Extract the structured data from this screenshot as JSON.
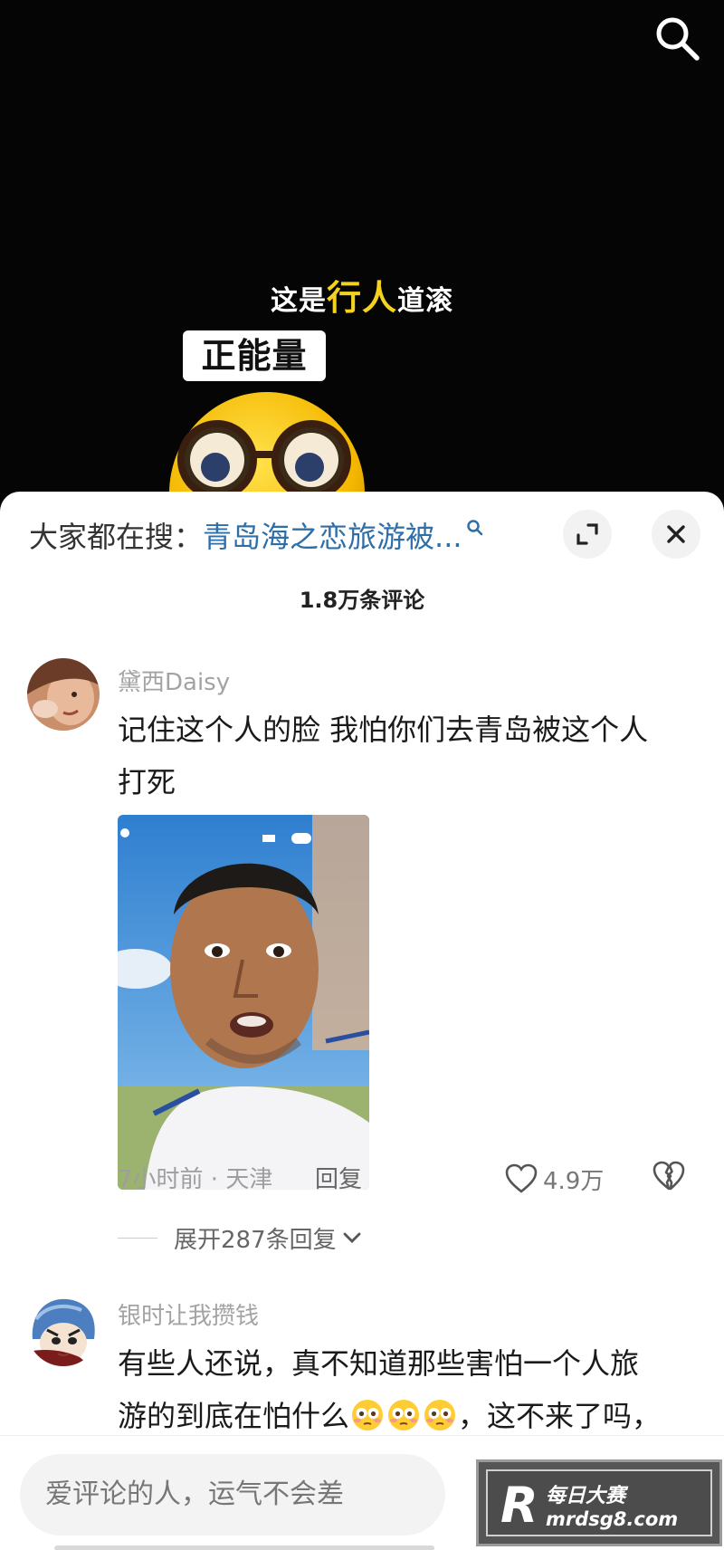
{
  "video": {
    "caption_pre": "这是",
    "caption_highlight": "行人",
    "caption_post": "道滚",
    "sticker_text": "正能量",
    "search_icon": "search-icon",
    "mascot": "yellow-emoji-with-glasses"
  },
  "sheet": {
    "trending_label": "大家都在搜：",
    "trending_query": "青岛海之恋旅游被...",
    "comment_count": "1.8万条评论",
    "icons": {
      "expand": "expand-icon",
      "close": "close-icon"
    }
  },
  "comments": [
    {
      "username": "黛西Daisy",
      "text_line1": "记住这个人的脸  我怕你们去青岛被这个人",
      "text_line2": "打死",
      "has_photo": true,
      "time_location": "7小时前 · 天津",
      "reply_label": "回复",
      "like_count": "4.9万",
      "expand_replies": "展开287条回复"
    },
    {
      "username": "银时让我攒钱",
      "text_line1": "有些人还说，真不知道那些害怕一个人旅",
      "text_line2_pre": "游的到底在怕什么",
      "text_line2_post": "，这不来了吗，",
      "emoji_count": 3
    }
  ],
  "input_bar": {
    "placeholder": "爱评论的人，运气不会差"
  },
  "watermark": {
    "line1": "每日大赛",
    "line2": "mrdsg8.com"
  },
  "colors": {
    "accent_link": "#2f6fa8",
    "caption_highlight": "#f4d21e",
    "sheet_bg": "#ffffff"
  }
}
